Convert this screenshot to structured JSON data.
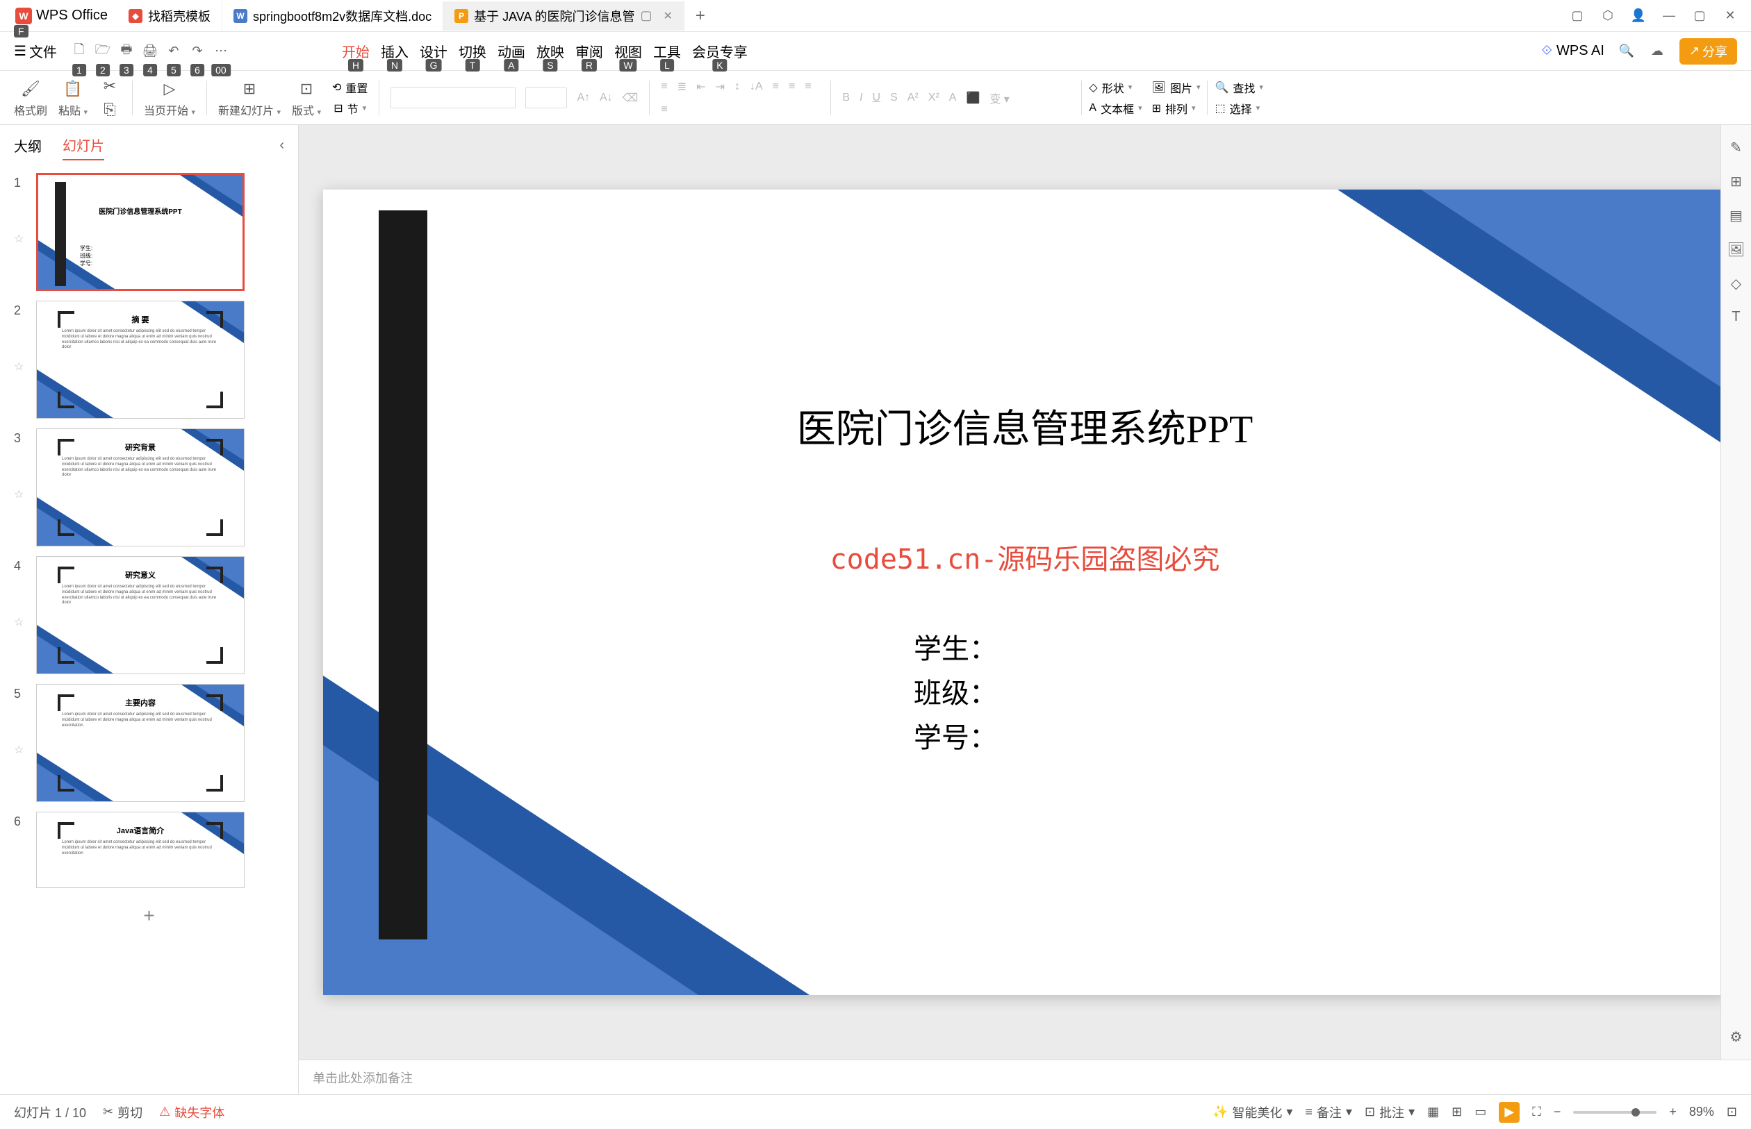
{
  "app": {
    "name": "WPS Office"
  },
  "tabs": [
    {
      "label": "找稻壳模板",
      "icon": "red"
    },
    {
      "label": "springbootf8m2v数据库文档.doc",
      "icon": "blue"
    },
    {
      "label": "基于 JAVA 的医院门诊信息管",
      "icon": "orange",
      "active": true
    }
  ],
  "menu": {
    "file": "文件",
    "items": [
      "开始",
      "插入",
      "设计",
      "切换",
      "动画",
      "放映",
      "审阅",
      "视图",
      "工具",
      "会员专享"
    ],
    "hints": [
      "H",
      "N",
      "G",
      "T",
      "A",
      "S",
      "R",
      "W",
      "L",
      "K"
    ],
    "file_hint": "F",
    "quick_hints": [
      "1",
      "2",
      "3",
      "4",
      "5",
      "6",
      "00"
    ],
    "ai": "WPS AI",
    "share": "分享"
  },
  "toolbar": {
    "format_brush": "格式刷",
    "paste": "粘贴",
    "current_start": "当页开始",
    "new_slide": "新建幻灯片",
    "layout": "版式",
    "section": "节",
    "reset": "重置",
    "shape": "形状",
    "image": "图片",
    "textbox": "文本框",
    "arrange": "排列",
    "find": "查找",
    "select": "选择"
  },
  "sidebar": {
    "tabs": {
      "outline": "大纲",
      "slides": "幻灯片"
    },
    "thumbs": [
      {
        "num": "1",
        "type": "title",
        "title": "医院门诊信息管理系统PPT",
        "info": "学生:\n班级:\n学号:"
      },
      {
        "num": "2",
        "type": "content",
        "heading": "摘  要"
      },
      {
        "num": "3",
        "type": "content",
        "heading": "研究背景"
      },
      {
        "num": "4",
        "type": "content",
        "heading": "研究意义"
      },
      {
        "num": "5",
        "type": "content",
        "heading": "主要内容"
      },
      {
        "num": "6",
        "type": "content",
        "heading": "Java语言简介"
      }
    ]
  },
  "slide": {
    "title": "医院门诊信息管理系统PPT",
    "watermark": "code51.cn-源码乐园盗图必究",
    "info1": "学生：",
    "info2": "班级：",
    "info3": "学号："
  },
  "notes": {
    "placeholder": "单击此处添加备注"
  },
  "status": {
    "slide_count": "幻灯片 1 / 10",
    "clip": "剪切",
    "missing_font": "缺失字体",
    "beautify": "智能美化",
    "notes": "备注",
    "comments": "批注",
    "zoom": "89%"
  },
  "bg_watermark": "code51.cn"
}
